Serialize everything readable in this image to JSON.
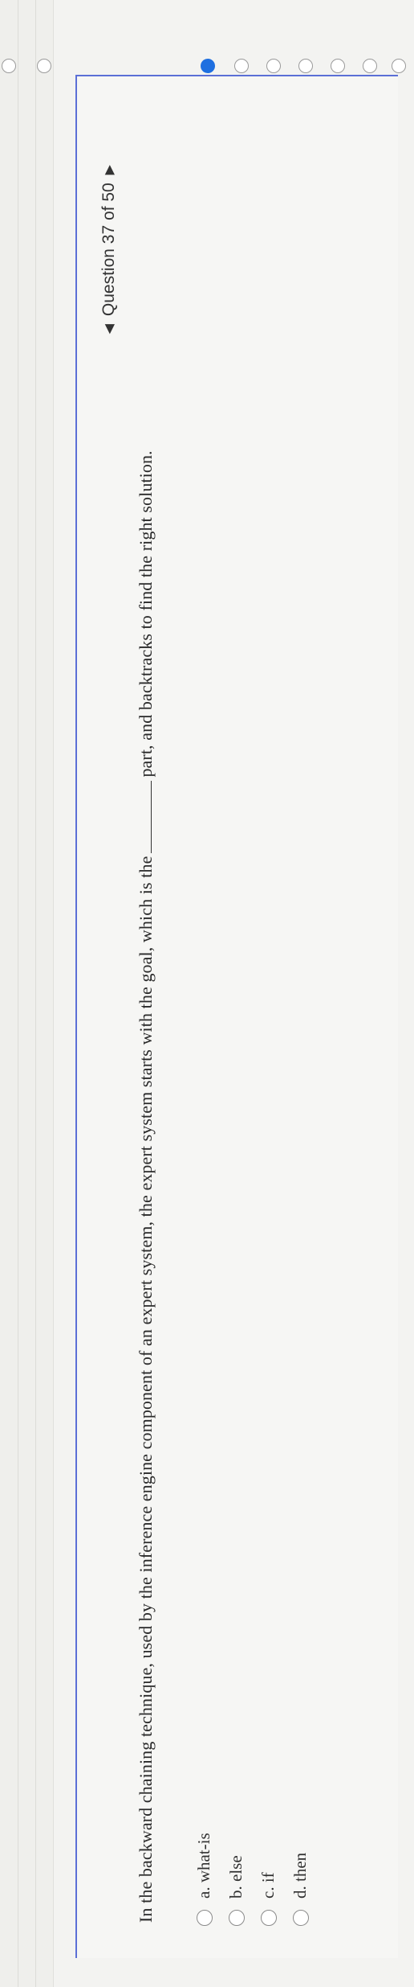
{
  "header": {
    "question_progress": "Question 37 of 50",
    "prev_icon": "triangle-left-icon",
    "next_icon": "triangle-right-icon"
  },
  "question": {
    "text_before": "In the backward chaining technique, used by the inference engine component of an expert system, the expert system starts with the goal, which is the",
    "text_after": "part, and backtracks to find the right solution."
  },
  "options": [
    {
      "label": "a. what-is"
    },
    {
      "label": "b. else"
    },
    {
      "label": "c. if"
    },
    {
      "label": "d. then"
    }
  ],
  "colors": {
    "accent": "#5b6fd6",
    "selected_radio": "#1e6fe0"
  }
}
